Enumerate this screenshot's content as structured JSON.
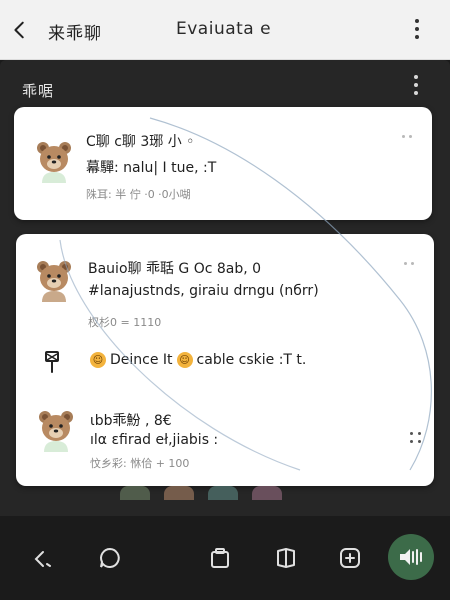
{
  "topbar": {
    "app_title": "来乖聊",
    "screen_title": "Evaiuata  e"
  },
  "section": {
    "title": "乖啹"
  },
  "card1": {
    "primary": "C聊 c聊 3琊 小 ◦",
    "secondary": "幕驒: nalu| I tue, :T",
    "meta": "陎⽿:      半 佇 ·0  ·0小㗅"
  },
  "card2": {
    "item1": {
      "primary": "Bauio聊  乖聒 G Oc    8ab, 0",
      "secondary": "#lanajustnds, giraiu drngu (nбrr)",
      "meta": "杈杉0 =  1110"
    },
    "reaction": {
      "part1": "Deince It",
      "part2": "cable cskie :T t."
    },
    "item2": {
      "primary": "ιbb乖魵 ,  8€",
      "secondary": "ılα ɛfirad eł,jiabis :",
      "meta": "忟乡彩:      恘佮 + 100"
    }
  },
  "icons": {
    "back": "chevron-left-icon",
    "more": "more-vertical-icon",
    "avatar": "bear-avatar-icon",
    "pin": "pin-icon",
    "emoji": "smiley-icon",
    "nav": [
      "back-gesture-icon",
      "chat-bubble-icon",
      "clipboard-icon",
      "book-icon",
      "add-box-icon",
      "broadcast-icon"
    ]
  },
  "colors": {
    "accent": "#3c6b49",
    "sheet": "#262626",
    "topbar": "#f2f2f2"
  }
}
